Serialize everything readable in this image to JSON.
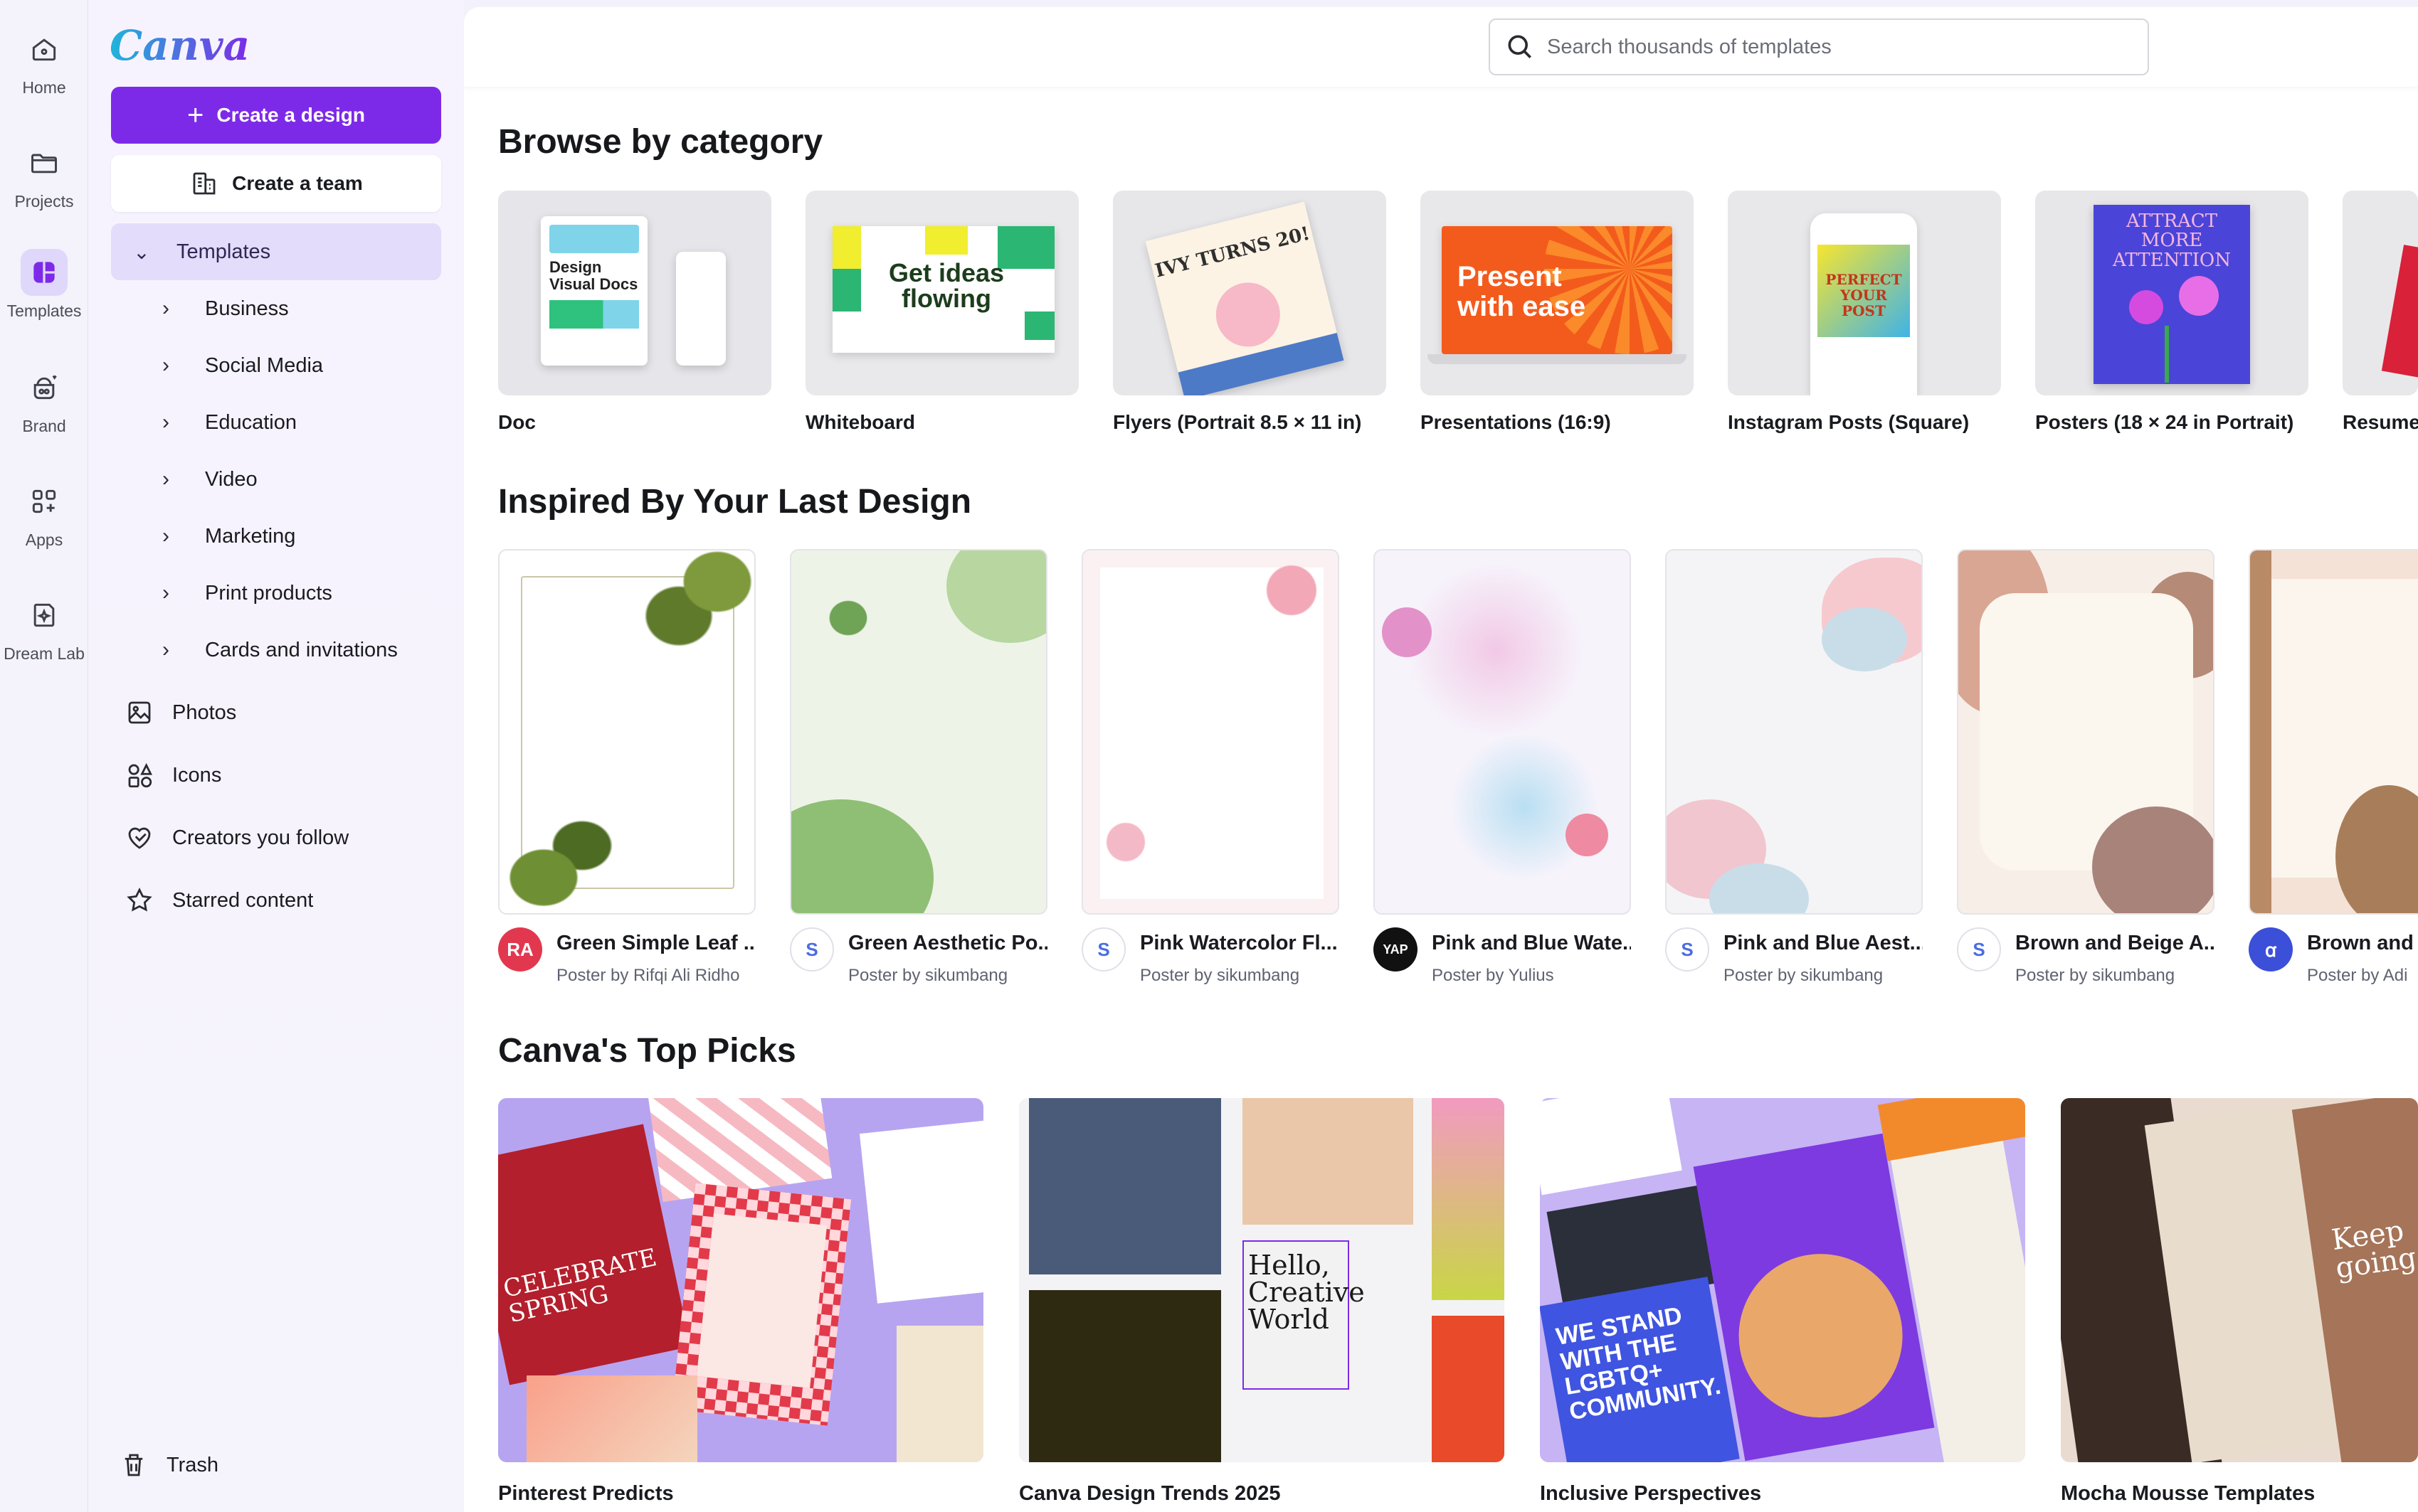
{
  "rail": {
    "items": [
      {
        "label": "Home",
        "icon": "home-icon"
      },
      {
        "label": "Projects",
        "icon": "folder-icon"
      },
      {
        "label": "Templates",
        "icon": "templates-icon"
      },
      {
        "label": "Brand",
        "icon": "brand-icon"
      },
      {
        "label": "Apps",
        "icon": "apps-icon"
      },
      {
        "label": "Dream Lab",
        "icon": "dream-lab-icon"
      }
    ]
  },
  "sidebar": {
    "logo": "Canva",
    "create_design": "Create a design",
    "create_team": "Create a team",
    "templates_label": "Templates",
    "sub_items": [
      "Business",
      "Social Media",
      "Education",
      "Video",
      "Marketing",
      "Print products",
      "Cards and invitations"
    ],
    "links": [
      {
        "label": "Photos",
        "icon": "photo-icon"
      },
      {
        "label": "Icons",
        "icon": "shapes-icon"
      },
      {
        "label": "Creators you follow",
        "icon": "heart-icon"
      },
      {
        "label": "Starred content",
        "icon": "star-icon"
      }
    ],
    "trash": "Trash"
  },
  "search": {
    "placeholder": "Search thousands of templates"
  },
  "sections": {
    "browse": "Browse by category",
    "inspired": "Inspired By Your Last Design",
    "top_picks": "Canva's Top Picks"
  },
  "categories": [
    {
      "label": "Doc",
      "thumb_text": "Design Visual Docs"
    },
    {
      "label": "Whiteboard",
      "thumb_text": "Get ideas flowing"
    },
    {
      "label": "Flyers (Portrait 8.5 × 11 in)",
      "thumb_text": "IVY TURNS 20!"
    },
    {
      "label": "Presentations (16:9)",
      "thumb_text": "Present with ease"
    },
    {
      "label": "Instagram Posts (Square)",
      "thumb_text": "PERFECT YOUR POST"
    },
    {
      "label": "Posters (18 × 24 in Portrait)",
      "thumb_text": "ATTRACT MORE ATTENTION"
    },
    {
      "label": "Resume",
      "thumb_text": ""
    }
  ],
  "inspired": [
    {
      "title": "Green Simple Leaf ...",
      "sub": "Poster by Rifqi Ali Ridho",
      "avatar": "RA",
      "avatar_color": "#e2384f"
    },
    {
      "title": "Green Aesthetic Po...",
      "sub": "Poster by sikumbang",
      "avatar": "S",
      "avatar_color": "#ffffff"
    },
    {
      "title": "Pink Watercolor Fl...",
      "sub": "Poster by sikumbang",
      "avatar": "S",
      "avatar_color": "#ffffff"
    },
    {
      "title": "Pink and Blue Wate...",
      "sub": "Poster by Yulius",
      "avatar": "YAP",
      "avatar_color": "#111111"
    },
    {
      "title": "Pink and Blue Aest...",
      "sub": "Poster by sikumbang",
      "avatar": "S",
      "avatar_color": "#ffffff"
    },
    {
      "title": "Brown and Beige A...",
      "sub": "Poster by sikumbang",
      "avatar": "S",
      "avatar_color": "#ffffff"
    },
    {
      "title": "Brown and I",
      "sub": "Poster by Adi",
      "avatar": "ꭤ",
      "avatar_color": "#3b4fd8"
    }
  ],
  "top_picks": [
    {
      "label": "Pinterest Predicts",
      "thumb_text": "CELEBRATE SPRING"
    },
    {
      "label": "Canva Design Trends 2025",
      "thumb_text": "Hello, Creative World"
    },
    {
      "label": "Inclusive Perspectives",
      "thumb_text": "WE STAND WITH THE LGBTQ+ COMMUNITY."
    },
    {
      "label": "Mocha Mousse Templates",
      "thumb_text": "Keep going"
    }
  ],
  "colors": {
    "accent": "#7d2ae8",
    "accent_light": "#e3dcfa"
  }
}
